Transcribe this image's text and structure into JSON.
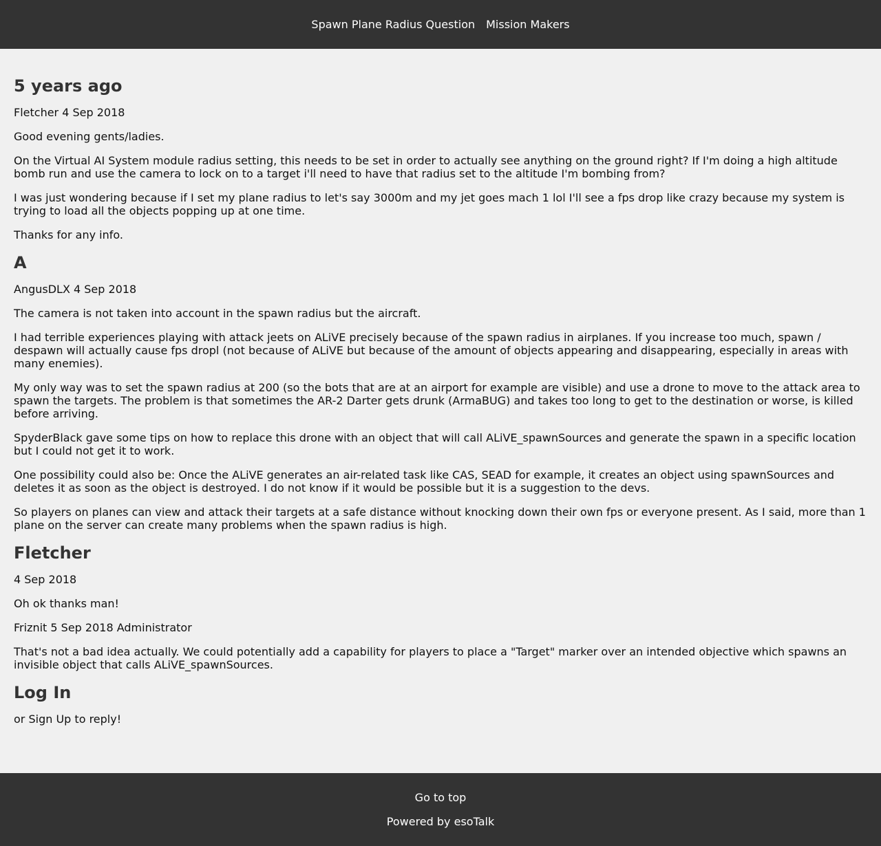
{
  "header": {
    "thread_title": "Spawn Plane Radius Question",
    "channel": "Mission Makers"
  },
  "posts": [
    {
      "heading": "5 years ago",
      "meta": "Fletcher 4 Sep 2018",
      "paragraphs": [
        "Good evening gents/ladies.",
        "On the Virtual AI System module radius setting, this needs to be set in order to actually see anything on the ground right? If I'm doing a high altitude bomb run and use the camera to lock on to a target i'll need to have that radius set to the altitude I'm bombing from?",
        "I was just wondering because if I set my plane radius to let's say 3000m and my jet goes mach 1 lol I'll see a fps drop like crazy because my system is trying to load all the objects popping up at one time.",
        "Thanks for any info."
      ]
    },
    {
      "heading": "A",
      "meta": "AngusDLX 4 Sep 2018",
      "paragraphs": [
        "The camera is not taken into account in the spawn radius but the aircraft.",
        "I had terrible experiences playing with attack jeets on ALiVE precisely because of the spawn radius in airplanes. If you increase too much, spawn / despawn will actually cause fps dropl (not because of ALiVE but because of the amount of objects appearing and disappearing, especially in areas with many enemies).",
        "My only way was to set the spawn radius at 200 (so the bots that are at an airport for example are visible) and use a drone to move to the attack area to spawn the targets. The problem is that sometimes the AR-2 Darter gets drunk (ArmaBUG) and takes too long to get to the destination or worse, is killed before arriving.",
        "SpyderBlack gave some tips on how to replace this drone with an object that will call ALiVE_spawnSources and generate the spawn in a specific location but I could not get it to work.",
        "One possibility could also be: Once the ALiVE generates an air-related task like CAS, SEAD for example, it creates an object using spawnSources and deletes it as soon as the object is destroyed. I do not know if it would be possible but it is a suggestion to the devs.",
        "So players on planes can view and attack their targets at a safe distance without knocking down their own fps or everyone present. As I said, more than 1 plane on the server can create many problems when the spawn radius is high."
      ]
    },
    {
      "heading": "Fletcher",
      "meta": "4 Sep 2018",
      "paragraphs": [
        "Oh ok thanks man!"
      ]
    },
    {
      "heading": "",
      "meta": "Friznit 5 Sep 2018 Administrator",
      "paragraphs": [
        "That's not a bad idea actually. We could potentially add a capability for players to place a \"Target\" marker over an intended objective which spawns an invisible object that calls ALiVE_spawnSources."
      ]
    }
  ],
  "login": {
    "heading": "Log In",
    "or": "or",
    "sign_up": "Sign Up",
    "to_reply": "to reply!"
  },
  "footer": {
    "go_to_top": "Go to top",
    "powered_by": "Powered by",
    "esotalk": "esoTalk"
  }
}
